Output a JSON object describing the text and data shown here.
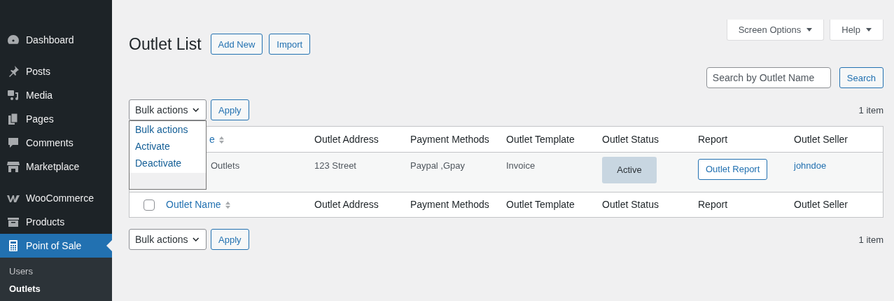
{
  "sidebar": {
    "items": [
      {
        "label": "Dashboard",
        "selected": false
      },
      {
        "label": "Posts",
        "selected": false
      },
      {
        "label": "Media",
        "selected": false
      },
      {
        "label": "Pages",
        "selected": false
      },
      {
        "label": "Comments",
        "selected": false
      },
      {
        "label": "Marketplace",
        "selected": false
      },
      {
        "label": "WooCommerce",
        "selected": false
      },
      {
        "label": "Products",
        "selected": false
      },
      {
        "label": "Point of Sale",
        "selected": true,
        "children": [
          {
            "label": "Users",
            "selected": false
          },
          {
            "label": "Outlets",
            "selected": true
          }
        ]
      }
    ]
  },
  "header": {
    "title": "Outlet List",
    "buttons": [
      "Add New",
      "Import"
    ],
    "screen_options": "Screen Options",
    "help": "Help"
  },
  "search": {
    "placeholder": "Search by Outlet Name",
    "button": "Search"
  },
  "bulk_top": {
    "value": "Bulk actions",
    "apply": "Apply",
    "count": "1 item",
    "expanded": true,
    "options": [
      "Bulk actions",
      "Activate",
      "Deactivate"
    ]
  },
  "table": {
    "columns": [
      "e",
      "Outlet Address",
      "Payment Methods",
      "Outlet Template",
      "Outlet Status",
      "Report",
      "Outlet Seller"
    ],
    "rows": [
      {
        "name": "Outlets",
        "address": "123 Street",
        "payment": "Paypal ,Gpay",
        "template": "Invoice",
        "status": "Active",
        "report": "Outlet Report",
        "seller": "johndoe"
      }
    ],
    "footer_columns": [
      "Outlet Name",
      "Outlet Address",
      "Payment Methods",
      "Outlet Template",
      "Outlet Status",
      "Report",
      "Outlet Seller"
    ],
    "footer_checked": false
  },
  "bulk_bottom": {
    "value": "Bulk actions",
    "apply": "Apply",
    "count": "1 item",
    "expanded": false
  }
}
